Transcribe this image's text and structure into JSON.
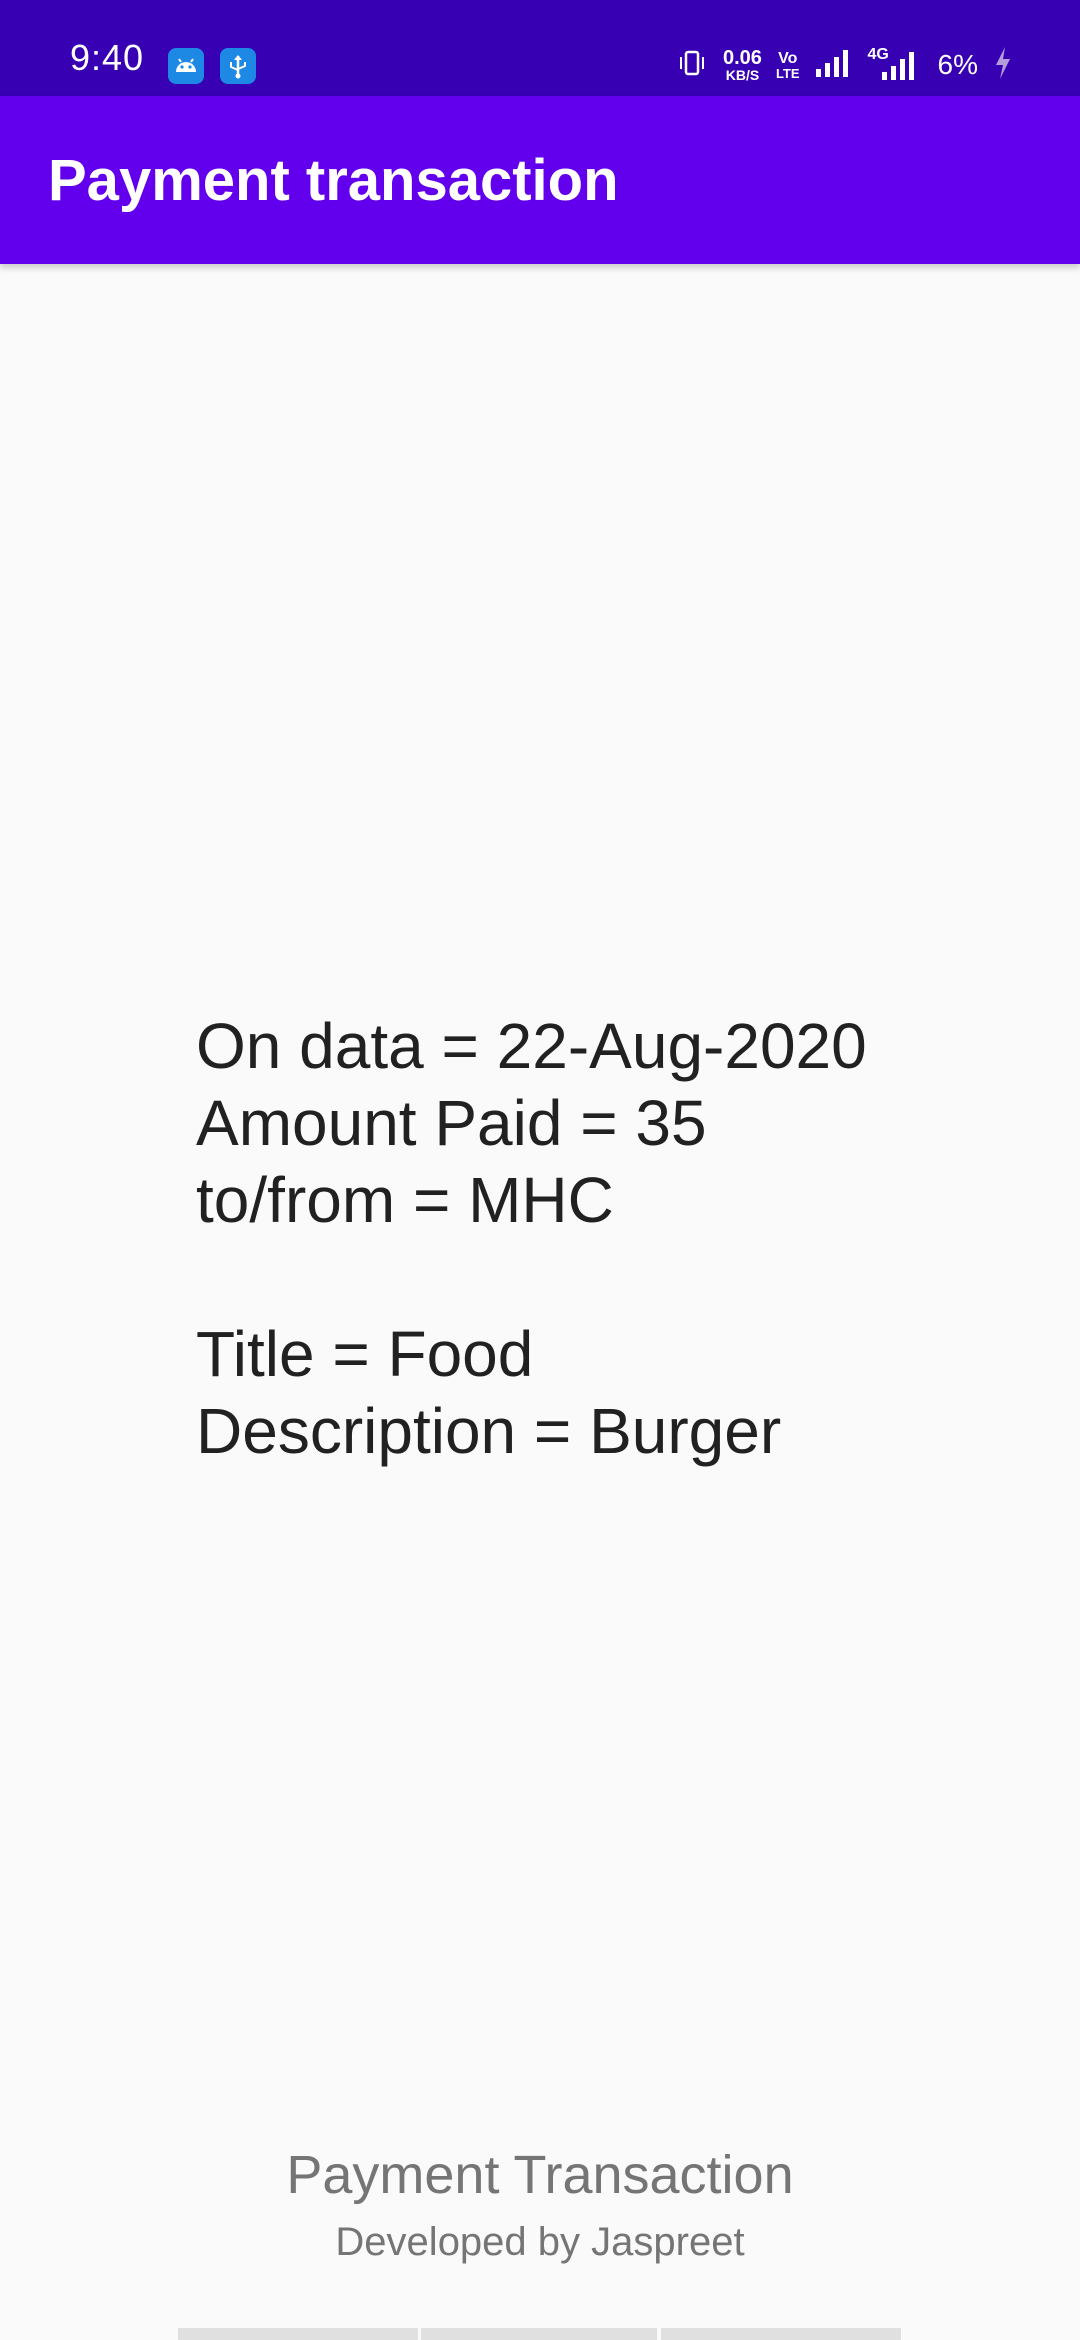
{
  "status_bar": {
    "time": "9:40",
    "net_speed_value": "0.06",
    "net_speed_unit": "KB/S",
    "volte_top": "Vo",
    "volte_bottom": "LTE",
    "network_type": "4G",
    "battery_percent": "6%",
    "icons": [
      "android-debug-icon",
      "usb-icon",
      "vibrate-icon",
      "signal-icon",
      "signal-4g-icon",
      "battery-charging-icon"
    ]
  },
  "app_bar": {
    "title": "Payment transaction"
  },
  "transaction": {
    "date_line": "On data = 22-Aug-2020",
    "amount_line": "Amount Paid = 35",
    "party_line": "to/from = MHC",
    "title_line": "Title = Food",
    "description_line": "Description = Burger"
  },
  "footer": {
    "title": "Payment Transaction",
    "subtitle": "Developed by Jaspreet"
  },
  "colors": {
    "status_bar": "#3700b3",
    "app_bar": "#6200ee",
    "background": "#fafafa",
    "text_primary": "#212121",
    "text_secondary": "#757575"
  }
}
